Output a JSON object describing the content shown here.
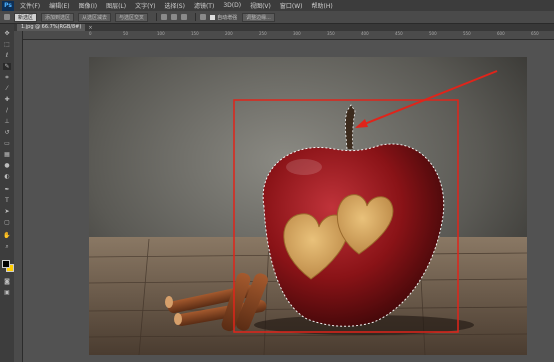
{
  "app": {
    "logo": "Ps"
  },
  "menu": [
    "文件(F)",
    "编辑(E)",
    "图像(I)",
    "图层(L)",
    "文字(Y)",
    "选择(S)",
    "滤镜(T)",
    "3D(D)",
    "视图(V)",
    "窗口(W)",
    "帮助(H)"
  ],
  "options": {
    "mode_label": "新选区",
    "buttons": [
      "添加到选区",
      "从选区减去",
      "与选区交叉"
    ],
    "feather": "羽化:",
    "auto_enhance": "自动增强",
    "refine_edge": "调整边缘..."
  },
  "document": {
    "tab_label": "1.jpg @ 66.7%(RGB/8#)",
    "close": "×"
  },
  "ruler": {
    "top": [
      "0",
      "50",
      "100",
      "150",
      "200",
      "250",
      "300",
      "350",
      "400",
      "450",
      "500",
      "550",
      "600",
      "650"
    ]
  },
  "colors": {
    "foreground": "#000000",
    "background": "#ffcc00",
    "selection_box": "#e0241a",
    "arrow": "#e0241a"
  },
  "icons": [
    "move-icon",
    "marquee-icon",
    "lasso-icon",
    "quick-selection-icon",
    "crop-icon",
    "eyedropper-icon",
    "healing-icon",
    "brush-icon",
    "stamp-icon",
    "history-brush-icon",
    "eraser-icon",
    "gradient-icon",
    "blur-icon",
    "dodge-icon",
    "pen-icon",
    "type-icon",
    "path-selection-icon",
    "shape-icon",
    "hand-icon",
    "zoom-icon"
  ]
}
